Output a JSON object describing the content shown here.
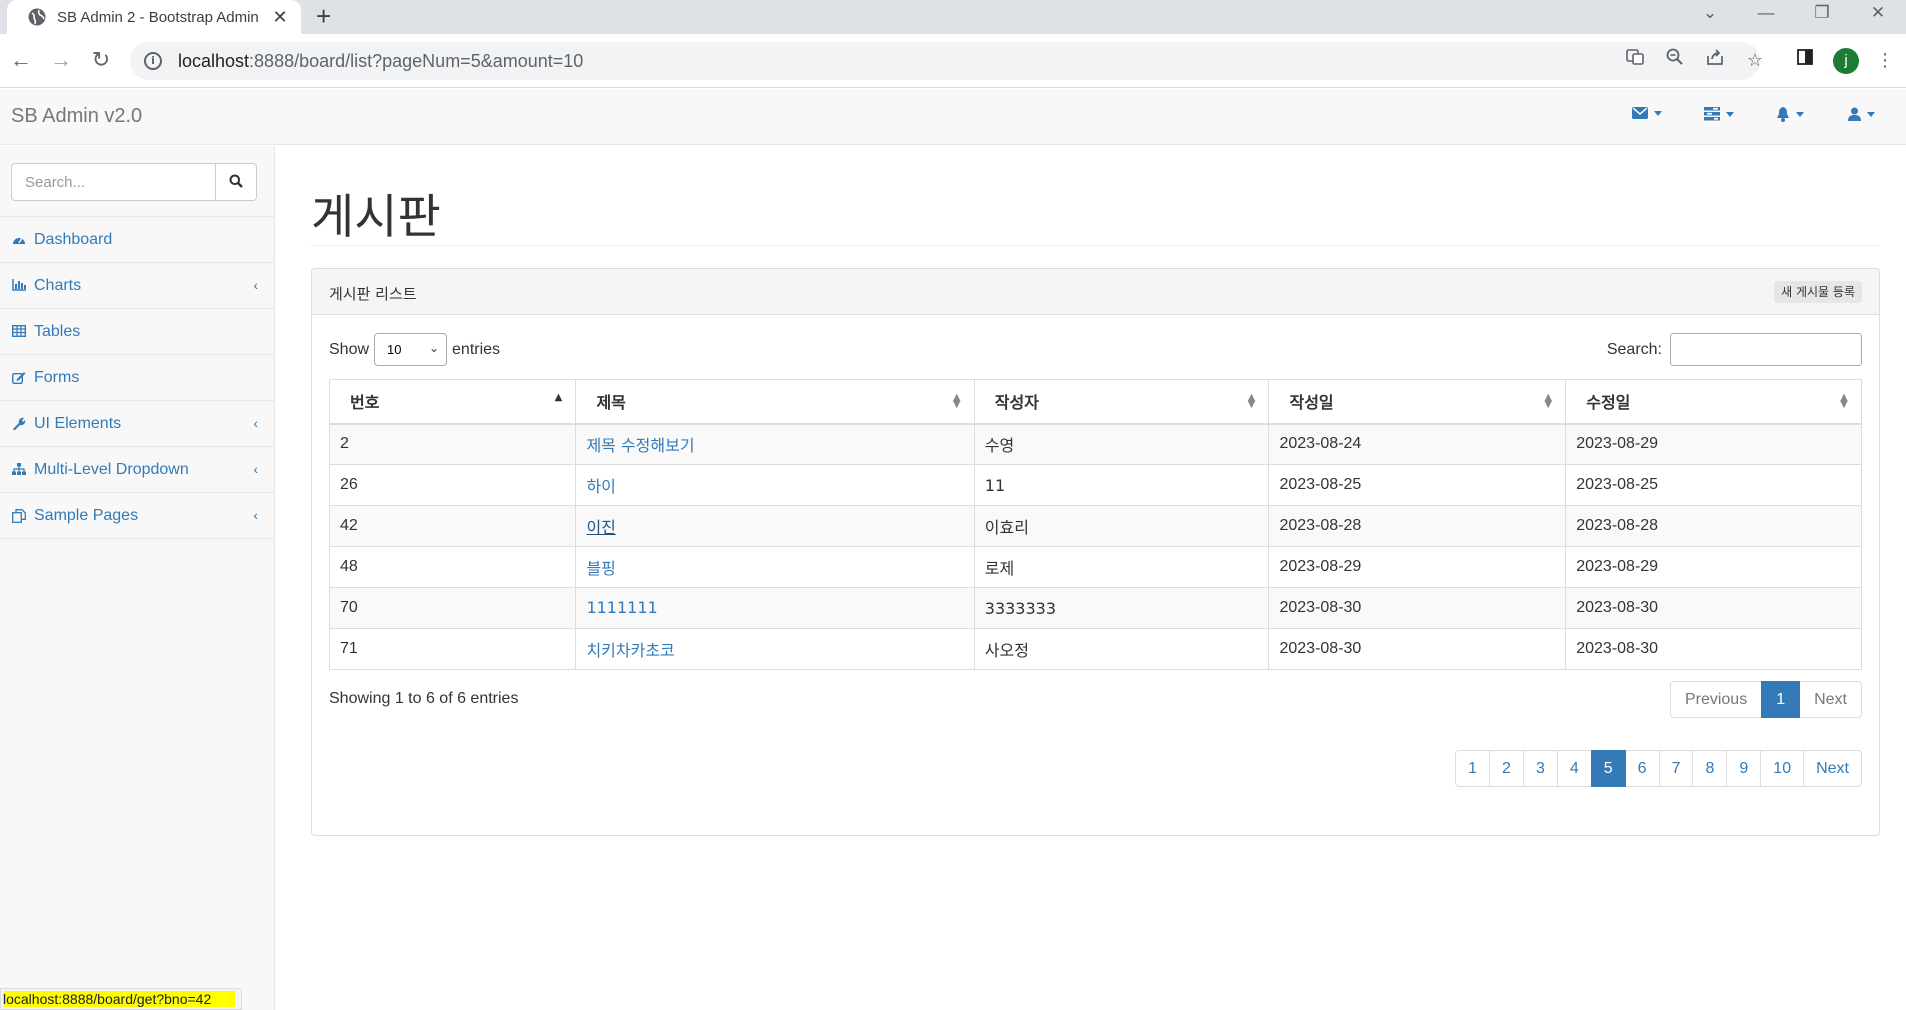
{
  "browser": {
    "tab_title": "SB Admin 2 - Bootstrap Admin",
    "url_host": "localhost",
    "url_rest": ":8888/board/list?pageNum=5&amount=10",
    "profile_initial": "j",
    "status_url": "localhost:8888/board/get?bno=42"
  },
  "navbar": {
    "brand": "SB Admin v2.0",
    "items": [
      {
        "icon": "envelope-icon"
      },
      {
        "icon": "tasks-icon"
      },
      {
        "icon": "bell-icon"
      },
      {
        "icon": "user-icon"
      }
    ]
  },
  "sidebar": {
    "search_placeholder": "Search...",
    "items": [
      {
        "label": "Dashboard",
        "icon": "dashboard-icon",
        "has_arrow": false
      },
      {
        "label": "Charts",
        "icon": "bar-chart-icon",
        "has_arrow": true
      },
      {
        "label": "Tables",
        "icon": "table-icon",
        "has_arrow": false
      },
      {
        "label": "Forms",
        "icon": "edit-icon",
        "has_arrow": false
      },
      {
        "label": "UI Elements",
        "icon": "wrench-icon",
        "has_arrow": true
      },
      {
        "label": "Multi-Level Dropdown",
        "icon": "sitemap-icon",
        "has_arrow": true
      },
      {
        "label": "Sample Pages",
        "icon": "files-icon",
        "has_arrow": true
      }
    ]
  },
  "page": {
    "title": "게시판",
    "panel_title": "게시판 리스트",
    "register_button": "새 게시물 등록"
  },
  "datatable": {
    "show_label": "Show",
    "entries_label": "entries",
    "page_length": "10",
    "search_label": "Search:",
    "columns": [
      "번호",
      "제목",
      "작성자",
      "작성일",
      "수정일"
    ],
    "rows": [
      [
        "2",
        "제목 수정해보기",
        "수영",
        "2023-08-24",
        "2023-08-29"
      ],
      [
        "26",
        "하이",
        "11",
        "2023-08-25",
        "2023-08-25"
      ],
      [
        "42",
        "이진",
        "이효리",
        "2023-08-28",
        "2023-08-28"
      ],
      [
        "48",
        "블핑",
        "로제",
        "2023-08-29",
        "2023-08-29"
      ],
      [
        "70",
        "1111111",
        "3333333",
        "2023-08-30",
        "2023-08-30"
      ],
      [
        "71",
        "치키차카초코",
        "사오정",
        "2023-08-30",
        "2023-08-30"
      ]
    ],
    "info": "Showing 1 to 6 of 6 entries",
    "pagination": {
      "previous": "Previous",
      "current": "1",
      "next": "Next"
    }
  },
  "board_pagination": {
    "pages": [
      "1",
      "2",
      "3",
      "4",
      "5",
      "6",
      "7",
      "8",
      "9",
      "10"
    ],
    "active": "5",
    "next": "Next"
  }
}
